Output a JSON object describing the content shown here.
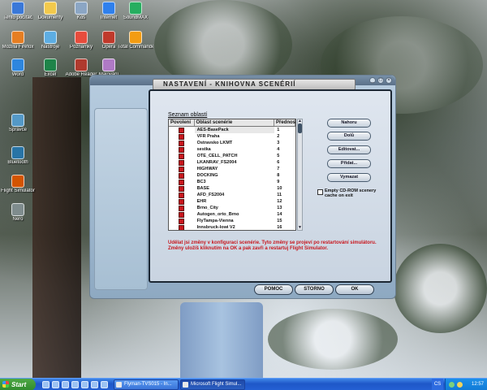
{
  "desktop_icons": [
    {
      "label": "Tento počítač",
      "color": "#3a78d8"
    },
    {
      "label": "Dokumenty",
      "color": "#f2c94c"
    },
    {
      "label": "Koš",
      "color": "#8ba6c4"
    },
    {
      "label": "Internet",
      "color": "#2f80ed"
    },
    {
      "label": "SoundMAX",
      "color": "#27ae60"
    },
    {
      "label": "Mozilla Firefox",
      "color": "#e67e22"
    },
    {
      "label": "Nástroje",
      "color": "#5dade2"
    },
    {
      "label": "Poznámky",
      "color": "#e74c3c"
    },
    {
      "label": "Opera",
      "color": "#c0392b"
    },
    {
      "label": "Total Commander",
      "color": "#f39c12"
    },
    {
      "label": "Word",
      "color": "#2e86de"
    },
    {
      "label": "Excel",
      "color": "#1e8449"
    },
    {
      "label": "Adobe Reader",
      "color": "#b03a2e"
    },
    {
      "label": "Malování",
      "color": "#af7ac5"
    },
    {
      "label": "Správce",
      "color": "#5499c7"
    },
    {
      "label": "Bluetooth",
      "color": "#2874a6"
    },
    {
      "label": "Flight Simulator",
      "color": "#d35400"
    },
    {
      "label": "Nero",
      "color": "#7f8c8d"
    }
  ],
  "dialog": {
    "title": "NASTAVENÍ - KNIHOVNA SCENÉRIÍ",
    "list_label": "Seznam oblastí",
    "columns": [
      "Povolení",
      "Oblast scenérie",
      "Přednost"
    ],
    "rows": [
      {
        "enabled": true,
        "name": "AES-BasePack",
        "priority": "1"
      },
      {
        "enabled": true,
        "name": "VFR Praha",
        "priority": "2"
      },
      {
        "enabled": true,
        "name": "Ostravsko LKMT",
        "priority": "3"
      },
      {
        "enabled": true,
        "name": "sestka",
        "priority": "4"
      },
      {
        "enabled": true,
        "name": "OTE_CELL_PATCH",
        "priority": "5"
      },
      {
        "enabled": true,
        "name": "LKANRAV_FS2004",
        "priority": "6"
      },
      {
        "enabled": true,
        "name": "HIGHWAY",
        "priority": "7"
      },
      {
        "enabled": true,
        "name": "DOCKING",
        "priority": "8"
      },
      {
        "enabled": true,
        "name": "BC3",
        "priority": "9"
      },
      {
        "enabled": true,
        "name": "BASE",
        "priority": "10"
      },
      {
        "enabled": true,
        "name": "AFD_FS2004",
        "priority": "11"
      },
      {
        "enabled": true,
        "name": "EHR",
        "priority": "12"
      },
      {
        "enabled": true,
        "name": "Brno_City",
        "priority": "13"
      },
      {
        "enabled": true,
        "name": "Autogen_orto_Brno",
        "priority": "14"
      },
      {
        "enabled": true,
        "name": "FlyTampa-Vienna",
        "priority": "15"
      },
      {
        "enabled": true,
        "name": "Innsbruck-lowi V2",
        "priority": "16"
      }
    ],
    "buttons": {
      "up": "Nahoru",
      "down": "Dolů",
      "edit": "Editovat...",
      "add": "Přidat...",
      "delete": "Vymazat"
    },
    "option_label": "Empty CD-ROM scenery cache on exit",
    "option_checked": false,
    "warning": "Udělat jsi změny v konfiguraci scenérie. Tyto změny se projeví po restartování simulátoru. Změny uložíš kliknutím na OK a pak zavři a restartuj Flight Simulator.",
    "footer": {
      "help": "POMOC",
      "cancel": "STORNO",
      "ok": "OK"
    }
  },
  "taskbar": {
    "start": "Start",
    "tasks": [
      {
        "label": "Flyman-TVS015 - In...",
        "active": false
      },
      {
        "label": "Microsoft Flight Simul...",
        "active": true
      }
    ],
    "language": "CS",
    "clock": "12:57"
  }
}
